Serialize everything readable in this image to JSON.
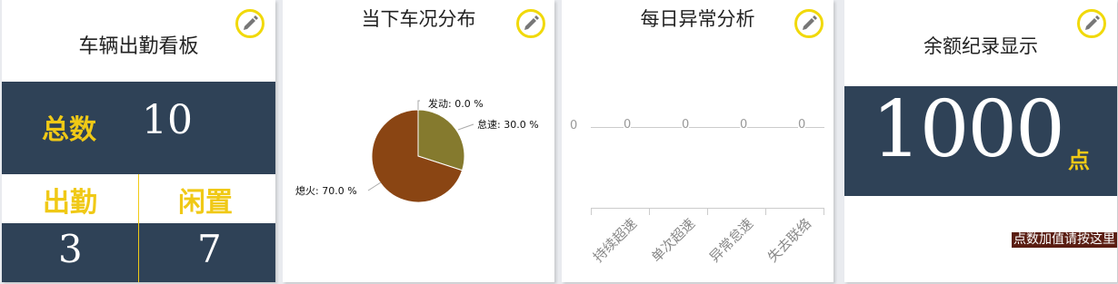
{
  "panel1": {
    "title": "车辆出勤看板",
    "total_label": "总数",
    "total_value": "10",
    "on_duty_label": "出勤",
    "idle_label": "闲置",
    "on_duty_value": "3",
    "idle_value": "7",
    "edit_icon": "pencil-icon"
  },
  "panel2": {
    "title": "当下车况分布",
    "edit_icon": "pencil-icon",
    "chart_data": {
      "type": "pie",
      "slices": [
        {
          "label": "发动",
          "value": 0.0,
          "color": "#d8c21a"
        },
        {
          "label": "怠速",
          "value": 30.0,
          "color": "#857a2e"
        },
        {
          "label": "熄火",
          "value": 70.0,
          "color": "#8a4513"
        }
      ],
      "labels_text": [
        "发动: 0.0 %",
        "怠速: 30.0 %",
        "熄火: 70.0 %"
      ]
    }
  },
  "panel3": {
    "title": "每日异常分析",
    "edit_icon": "pencil-icon",
    "chart_data": {
      "type": "line",
      "categories": [
        "持续超速",
        "单次超速",
        "异常怠速",
        "失去联络"
      ],
      "values": [
        0,
        0,
        0,
        0
      ],
      "y_tick": "0",
      "value_labels": [
        "0",
        "0",
        "0",
        "0"
      ]
    }
  },
  "panel4": {
    "title": "余额纪录显示",
    "amount": "1000",
    "unit": "点",
    "topup_link": "点数加值请按这里",
    "edit_icon": "pencil-icon"
  }
}
